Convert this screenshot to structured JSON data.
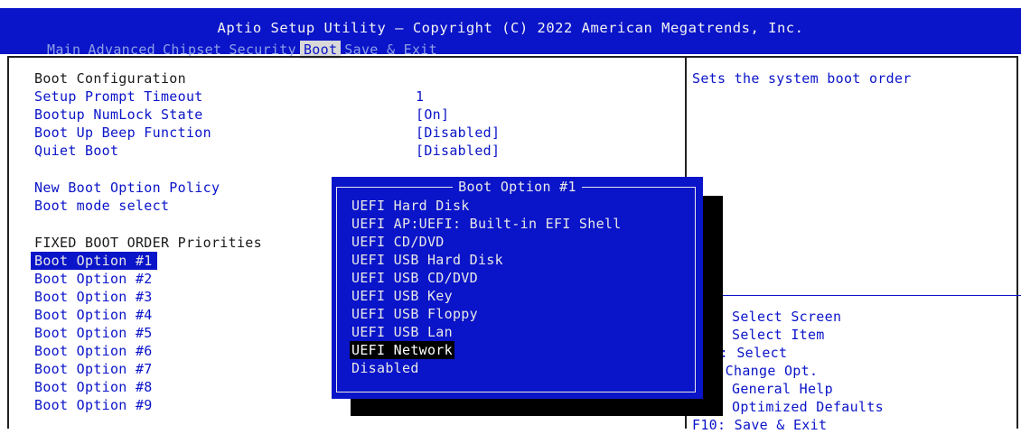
{
  "header": {
    "title": "Aptio Setup Utility – Copyright (C) 2022 American Megatrends, Inc.",
    "tabs": [
      "Main",
      "Advanced",
      "Chipset",
      "Security",
      "Boot",
      "Save & Exit"
    ],
    "active_tab": "Boot"
  },
  "settings": {
    "boot_configuration": "Boot Configuration",
    "setup_prompt_timeout": {
      "label": "Setup Prompt Timeout",
      "value": "1"
    },
    "bootup_numlock": {
      "label": "Bootup NumLock State",
      "value": "[On]"
    },
    "boot_beep": {
      "label": "Boot Up Beep Function",
      "value": "[Disabled]"
    },
    "quiet_boot": {
      "label": "Quiet Boot",
      "value": "[Disabled]"
    },
    "new_boot_option_policy": "New Boot Option Policy",
    "boot_mode_select": "Boot mode select",
    "fixed_boot_order": "FIXED BOOT ORDER Priorities",
    "boot_options": [
      "Boot Option #1",
      "Boot Option #2",
      "Boot Option #3",
      "Boot Option #4",
      "Boot Option #5",
      "Boot Option #6",
      "Boot Option #7",
      "Boot Option #8",
      "Boot Option #9"
    ]
  },
  "help": {
    "description": "Sets the system boot order",
    "keys": [
      "Select Screen",
      "Select Item",
      "er: Select",
      ": Change Opt.",
      "General Help",
      "Optimized Defaults",
      "F10: Save & Exit"
    ]
  },
  "popup": {
    "title": "Boot Option #1",
    "options": [
      "UEFI Hard Disk",
      "UEFI AP:UEFI: Built-in EFI Shell",
      "UEFI CD/DVD",
      "UEFI USB Hard Disk",
      "UEFI USB CD/DVD",
      "UEFI USB Key",
      "UEFI USB Floppy",
      "UEFI USB Lan",
      "UEFI Network",
      "Disabled"
    ],
    "selected": "UEFI Network"
  },
  "colors": {
    "bios_blue": "#0a14c8",
    "panel_bg": "#ffffff",
    "highlight": "#000000"
  }
}
